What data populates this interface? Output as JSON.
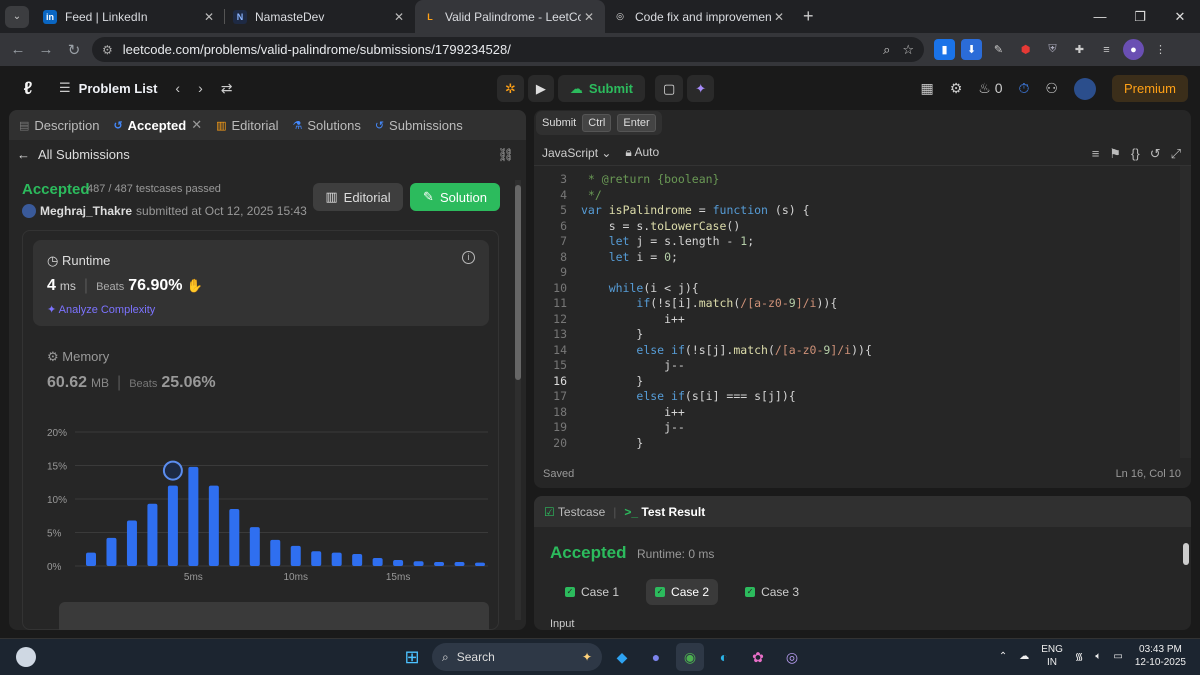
{
  "browser": {
    "tabs": [
      {
        "title": "Feed | LinkedIn",
        "favicon": "in",
        "color": "#0a66c2"
      },
      {
        "title": "NamasteDev",
        "favicon": "N",
        "color": "#1e2a44"
      },
      {
        "title": "Valid Palindrome - LeetCode",
        "favicon": "L",
        "color": "#ffa116",
        "active": true
      },
      {
        "title": "Code fix and improvement",
        "favicon": "◎",
        "color": "#555"
      }
    ],
    "url": "leetcode.com/problems/valid-palindrome/submissions/1799234528/"
  },
  "nav": {
    "problem_list": "Problem List",
    "submit": "Submit",
    "fire_count": "0",
    "premium": "Premium"
  },
  "left_tabs": [
    "Description",
    "Accepted",
    "Editorial",
    "Solutions",
    "Submissions"
  ],
  "submission": {
    "back_label": "All Submissions",
    "status": "Accepted",
    "testcases": "487 / 487 testcases passed",
    "user": "Meghraj_Thakre",
    "submitted_at": "submitted at Oct 12, 2025 15:43",
    "editorial_btn": "Editorial",
    "solution_btn": "Solution"
  },
  "runtime": {
    "title": "Runtime",
    "value": "4",
    "unit": "ms",
    "beats_label": "Beats",
    "beats": "76.90%",
    "analyze": "Analyze Complexity"
  },
  "memory": {
    "title": "Memory",
    "value": "60.62",
    "unit": "MB",
    "beats_label": "Beats",
    "beats": "25.06%"
  },
  "chart_data": {
    "type": "bar",
    "y_ticks": [
      "20%",
      "15%",
      "10%",
      "5%",
      "0%"
    ],
    "x_ticks": [
      "5ms",
      "10ms",
      "15ms"
    ],
    "ylim": [
      0,
      20
    ],
    "values": [
      2,
      4.2,
      6.8,
      9.3,
      12,
      14.8,
      12,
      8.5,
      5.8,
      3.9,
      3,
      2.2,
      2,
      1.8,
      1.2,
      0.9,
      0.7,
      0.6,
      0.6,
      0.5
    ],
    "highlight_index": 4,
    "bar_color": "#2f6ff0"
  },
  "editor": {
    "tooltip": {
      "label": "Submit",
      "keys": [
        "Ctrl",
        "Enter"
      ]
    },
    "language": "JavaScript",
    "mode": "Auto",
    "lines": [
      {
        "n": "3",
        "t": " * @return {boolean}"
      },
      {
        "n": "4",
        "t": " */"
      },
      {
        "n": "5",
        "t": "var isPalindrome = function (s) {"
      },
      {
        "n": "6",
        "t": "    s = s.toLowerCase()"
      },
      {
        "n": "7",
        "t": "    let j = s.length - 1;"
      },
      {
        "n": "8",
        "t": "    let i = 0;"
      },
      {
        "n": "9",
        "t": ""
      },
      {
        "n": "10",
        "t": "    while(i < j){"
      },
      {
        "n": "11",
        "t": "        if(!s[i].match(/[a-z0-9]/i)){"
      },
      {
        "n": "12",
        "t": "            i++"
      },
      {
        "n": "13",
        "t": "        }"
      },
      {
        "n": "14",
        "t": "        else if(!s[j].match(/[a-z0-9]/i)){"
      },
      {
        "n": "15",
        "t": "            j--"
      },
      {
        "n": "16",
        "t": "        }"
      },
      {
        "n": "17",
        "t": "        else if(s[i] === s[j]){"
      },
      {
        "n": "18",
        "t": "            i++"
      },
      {
        "n": "19",
        "t": "            j--"
      },
      {
        "n": "20",
        "t": "        }"
      }
    ],
    "saved": "Saved",
    "position": "Ln 16, Col 10"
  },
  "result": {
    "tab_testcase": "Testcase",
    "tab_result": "Test Result",
    "status": "Accepted",
    "runtime": "Runtime: 0 ms",
    "cases": [
      "Case 1",
      "Case 2",
      "Case 3"
    ],
    "input_label": "Input"
  },
  "taskbar": {
    "search": "Search",
    "lang": "ENG",
    "region": "IN",
    "time": "03:43 PM",
    "date": "12-10-2025"
  }
}
